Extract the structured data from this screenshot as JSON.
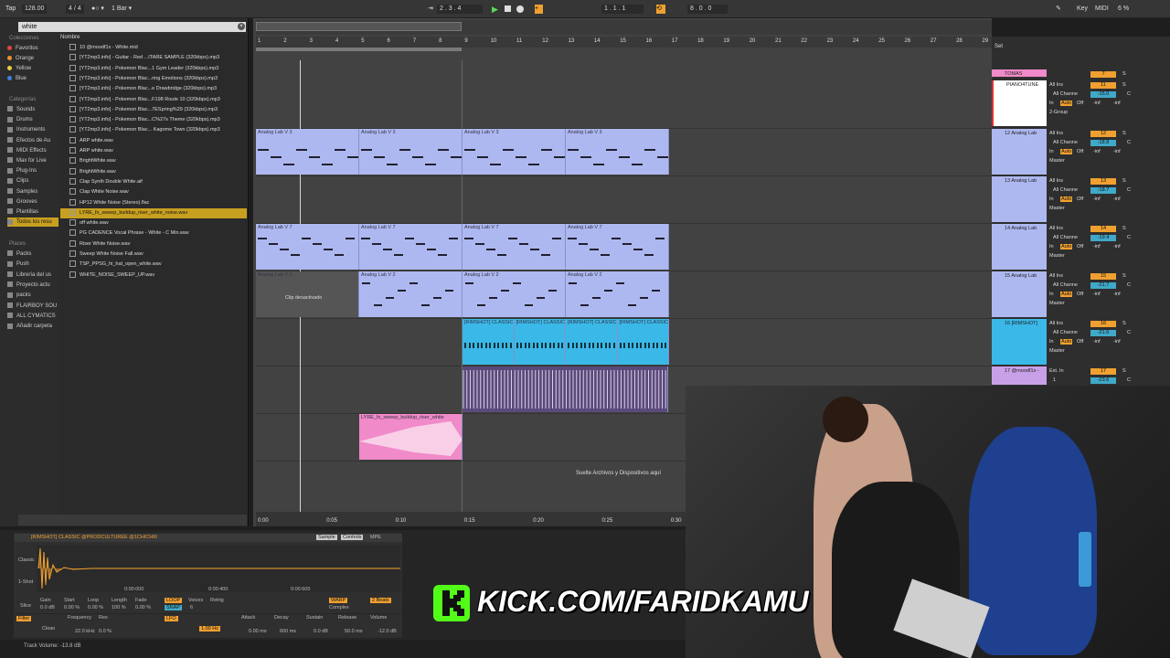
{
  "transport": {
    "tap": "Tap",
    "tempo": "128.00",
    "signature": "4 / 4",
    "metro": "●○ ▾",
    "quantize": "1 Bar ▾",
    "position": "2 .  3 .  4",
    "loop_start": "1 .  1 .  1",
    "loop_len": "8 .  0 .  0",
    "key": "Key",
    "midi": "MIDI",
    "cpu": "6 %"
  },
  "browser": {
    "search_value": "white",
    "collections_title": "Colecciones",
    "collections": [
      {
        "label": "Favoritos",
        "color": "#e84040"
      },
      {
        "label": "Orange",
        "color": "#f09030"
      },
      {
        "label": "Yellow",
        "color": "#e8d040"
      },
      {
        "label": "Blue",
        "color": "#4080e0"
      }
    ],
    "categories_title": "Categorías",
    "categories": [
      "Sounds",
      "Drums",
      "Instruments",
      "Efectos de Au",
      "MIDI Effects",
      "Max for Live",
      "Plug-Ins",
      "Clips",
      "Samples",
      "Grooves",
      "Plantillas",
      "Todos los resu"
    ],
    "places_title": "Places",
    "places": [
      "Packs",
      "Push",
      "Librería del us",
      "Proyecto actu",
      "packs",
      "FLAIRBOY SOU",
      "ALL CYMATICS",
      "Añadir carpeta"
    ],
    "column_header": "Nombre",
    "files": [
      "10 @moodf1x - White.mid",
      "[YT2mp3.info] - Guitar - Red ...ITARE SAMPLE (320kbps).mp3",
      "[YT2mp3.info] - Pokemon Blac...1 Gym Leader (320kbps).mp3",
      "[YT2mp3.info] - Pokemon Blac...ring Emotions (320kbps).mp3",
      "[YT2mp3.info] - Pokemon Blac...e Drawbridge (320kbps).mp3",
      "[YT2mp3.info] - Pokemon Blac...F198 Route 10 (320kbps).mp3",
      "[YT2mp3.info] - Pokemon Blac...7ESpring%29 (320kbps).mp3",
      "[YT2mp3.info] - Pokemon Blac...C%27s Theme (320kbps).mp3",
      "[YT2mp3.info] - Pokemon Blac... Kagome Town (320kbps).mp3",
      "ARP white.wav",
      "ARP white.wav",
      "BrightWhite.wav",
      "BrightWhite.wav",
      "Clap Synth Double White.aif",
      "Clap White Noise.wav",
      "HP12 White Noise (Stereo).flac",
      "LYRE_fx_sweep_buildup_riser_white_noise.wav",
      "off white.wav",
      "PG CADENCE Vocal Phrase - White - C Min.wav",
      "Riser White Noise.wav",
      "Sweep White Noise Fall.wav",
      "TSP_PPSG_hi_hat_open_white.wav",
      "WHITE_NOISE_SWEEP_UP.wav"
    ],
    "selected_index": 16
  },
  "arrangement": {
    "bars": [
      "1",
      "2",
      "3",
      "4",
      "5",
      "6",
      "7",
      "8",
      "9",
      "10",
      "11",
      "12",
      "13",
      "14",
      "15",
      "16",
      "17",
      "18",
      "19",
      "20",
      "21",
      "22",
      "23",
      "24",
      "25",
      "26",
      "27",
      "28",
      "29"
    ],
    "times": [
      "0:00",
      "0:05",
      "0:10",
      "0:15",
      "0:20",
      "0:25",
      "0:30"
    ],
    "clips": {
      "lab3": "Analog Lab V 3",
      "lab7": "Analog Lab V 7",
      "lab2": "Analog Lab V 2",
      "deactivated": "Clip desactivado",
      "rimshot": "[RIMSHOT] CLASSIC",
      "riser": "LYRE_fx_sweep_buildup_riser_white"
    },
    "drop_hint": "Suelte Archivos y Dispositivos aquí"
  },
  "mixer": {
    "set_label": "Set",
    "tracks": [
      {
        "name": "TOMAS",
        "num": "7",
        "color": "#f08ac8"
      },
      {
        "name": "PIANO4TUNE",
        "num": "11",
        "vol": "-15.0",
        "color": "#ffffff",
        "input": "All Ins",
        "channel": "All Channe",
        "group": "2-Group"
      },
      {
        "name": "12 Analog Lab",
        "num": "12",
        "vol": "-18.8",
        "color": "#aeb8f0",
        "input": "All Ins",
        "channel": "All Channe",
        "out": "Master"
      },
      {
        "name": "13 Analog Lab",
        "num": "13",
        "vol": "-18.7",
        "color": "#aeb8f0",
        "input": "All Ins",
        "channel": "All Channe",
        "out": "Master"
      },
      {
        "name": "14 Analog Lab",
        "num": "14",
        "vol": "-19.4",
        "color": "#aeb8f0",
        "input": "All Ins",
        "channel": "All Channe",
        "out": "Master"
      },
      {
        "name": "15 Analog Lab",
        "num": "15",
        "vol": "-21.7",
        "color": "#aeb8f0",
        "input": "All Ins",
        "channel": "All Channe",
        "out": "Master"
      },
      {
        "name": "16 [RIMSHOT]",
        "num": "16",
        "vol": "-21.6",
        "color": "#3ab8e8",
        "input": "All Ins",
        "channel": "All Channe",
        "out": "Master"
      },
      {
        "name": "17 @moodf1x -",
        "num": "17",
        "vol": "-23.6",
        "color": "#c8a0e8",
        "input": "Ext. In",
        "channel": "1"
      }
    ],
    "auto": "Auto",
    "off": "Off",
    "in_label": "In",
    "inf": "-inf",
    "c": "C",
    "s": "S"
  },
  "device": {
    "title": "[RIMSHOT] CLASSIC @PRODCULTUREE @1CHICHIII",
    "tab_sample": "Sample",
    "tab_controls": "Controls",
    "tab_mpe": "MPE",
    "mode": "Classic",
    "mode2": "1-Shot",
    "mode3": "Slice",
    "time_a": "0:00:000",
    "time_b": "0:00:400",
    "time_c": "0:00:600",
    "params": [
      {
        "label": "Gain",
        "value": "0.0 dB"
      },
      {
        "label": "Start",
        "value": "0.00 %"
      },
      {
        "label": "Loop",
        "value": "0.00 %"
      },
      {
        "label": "Length",
        "value": "100 %"
      },
      {
        "label": "Fade",
        "value": "0.00 %"
      }
    ],
    "loop_tag": "LOOP",
    "snap_tag": "SNAP",
    "voices_label": "Voices",
    "voices_value": "6",
    "retrig_label": "Retrig",
    "warp": "WARP",
    "beats": "2 Beats",
    "complex": "Complex",
    "filter_label": "Filter",
    "filter_type": "Clean",
    "freq_label": "Frequency",
    "freq_value": "22.0 kHz",
    "res_label": "Res",
    "res_value": "0.0 %",
    "lfo_label": "LFO",
    "lfo_hz": "1.00 Hz",
    "attack_label": "Attack",
    "attack_value": "0.00 ms",
    "decay_label": "Decay",
    "decay_value": "600 ms",
    "sustain_label": "Sustain",
    "sustain_value": "0.0 dB",
    "release_label": "Release",
    "release_value": "50.0 ms",
    "volume_label": "Volume",
    "volume_value": "-12.0 dB"
  },
  "status": "Track Volume: -13.8 dB",
  "overlay": {
    "kick_text": "KICK.COM/FARIDKAMU"
  }
}
